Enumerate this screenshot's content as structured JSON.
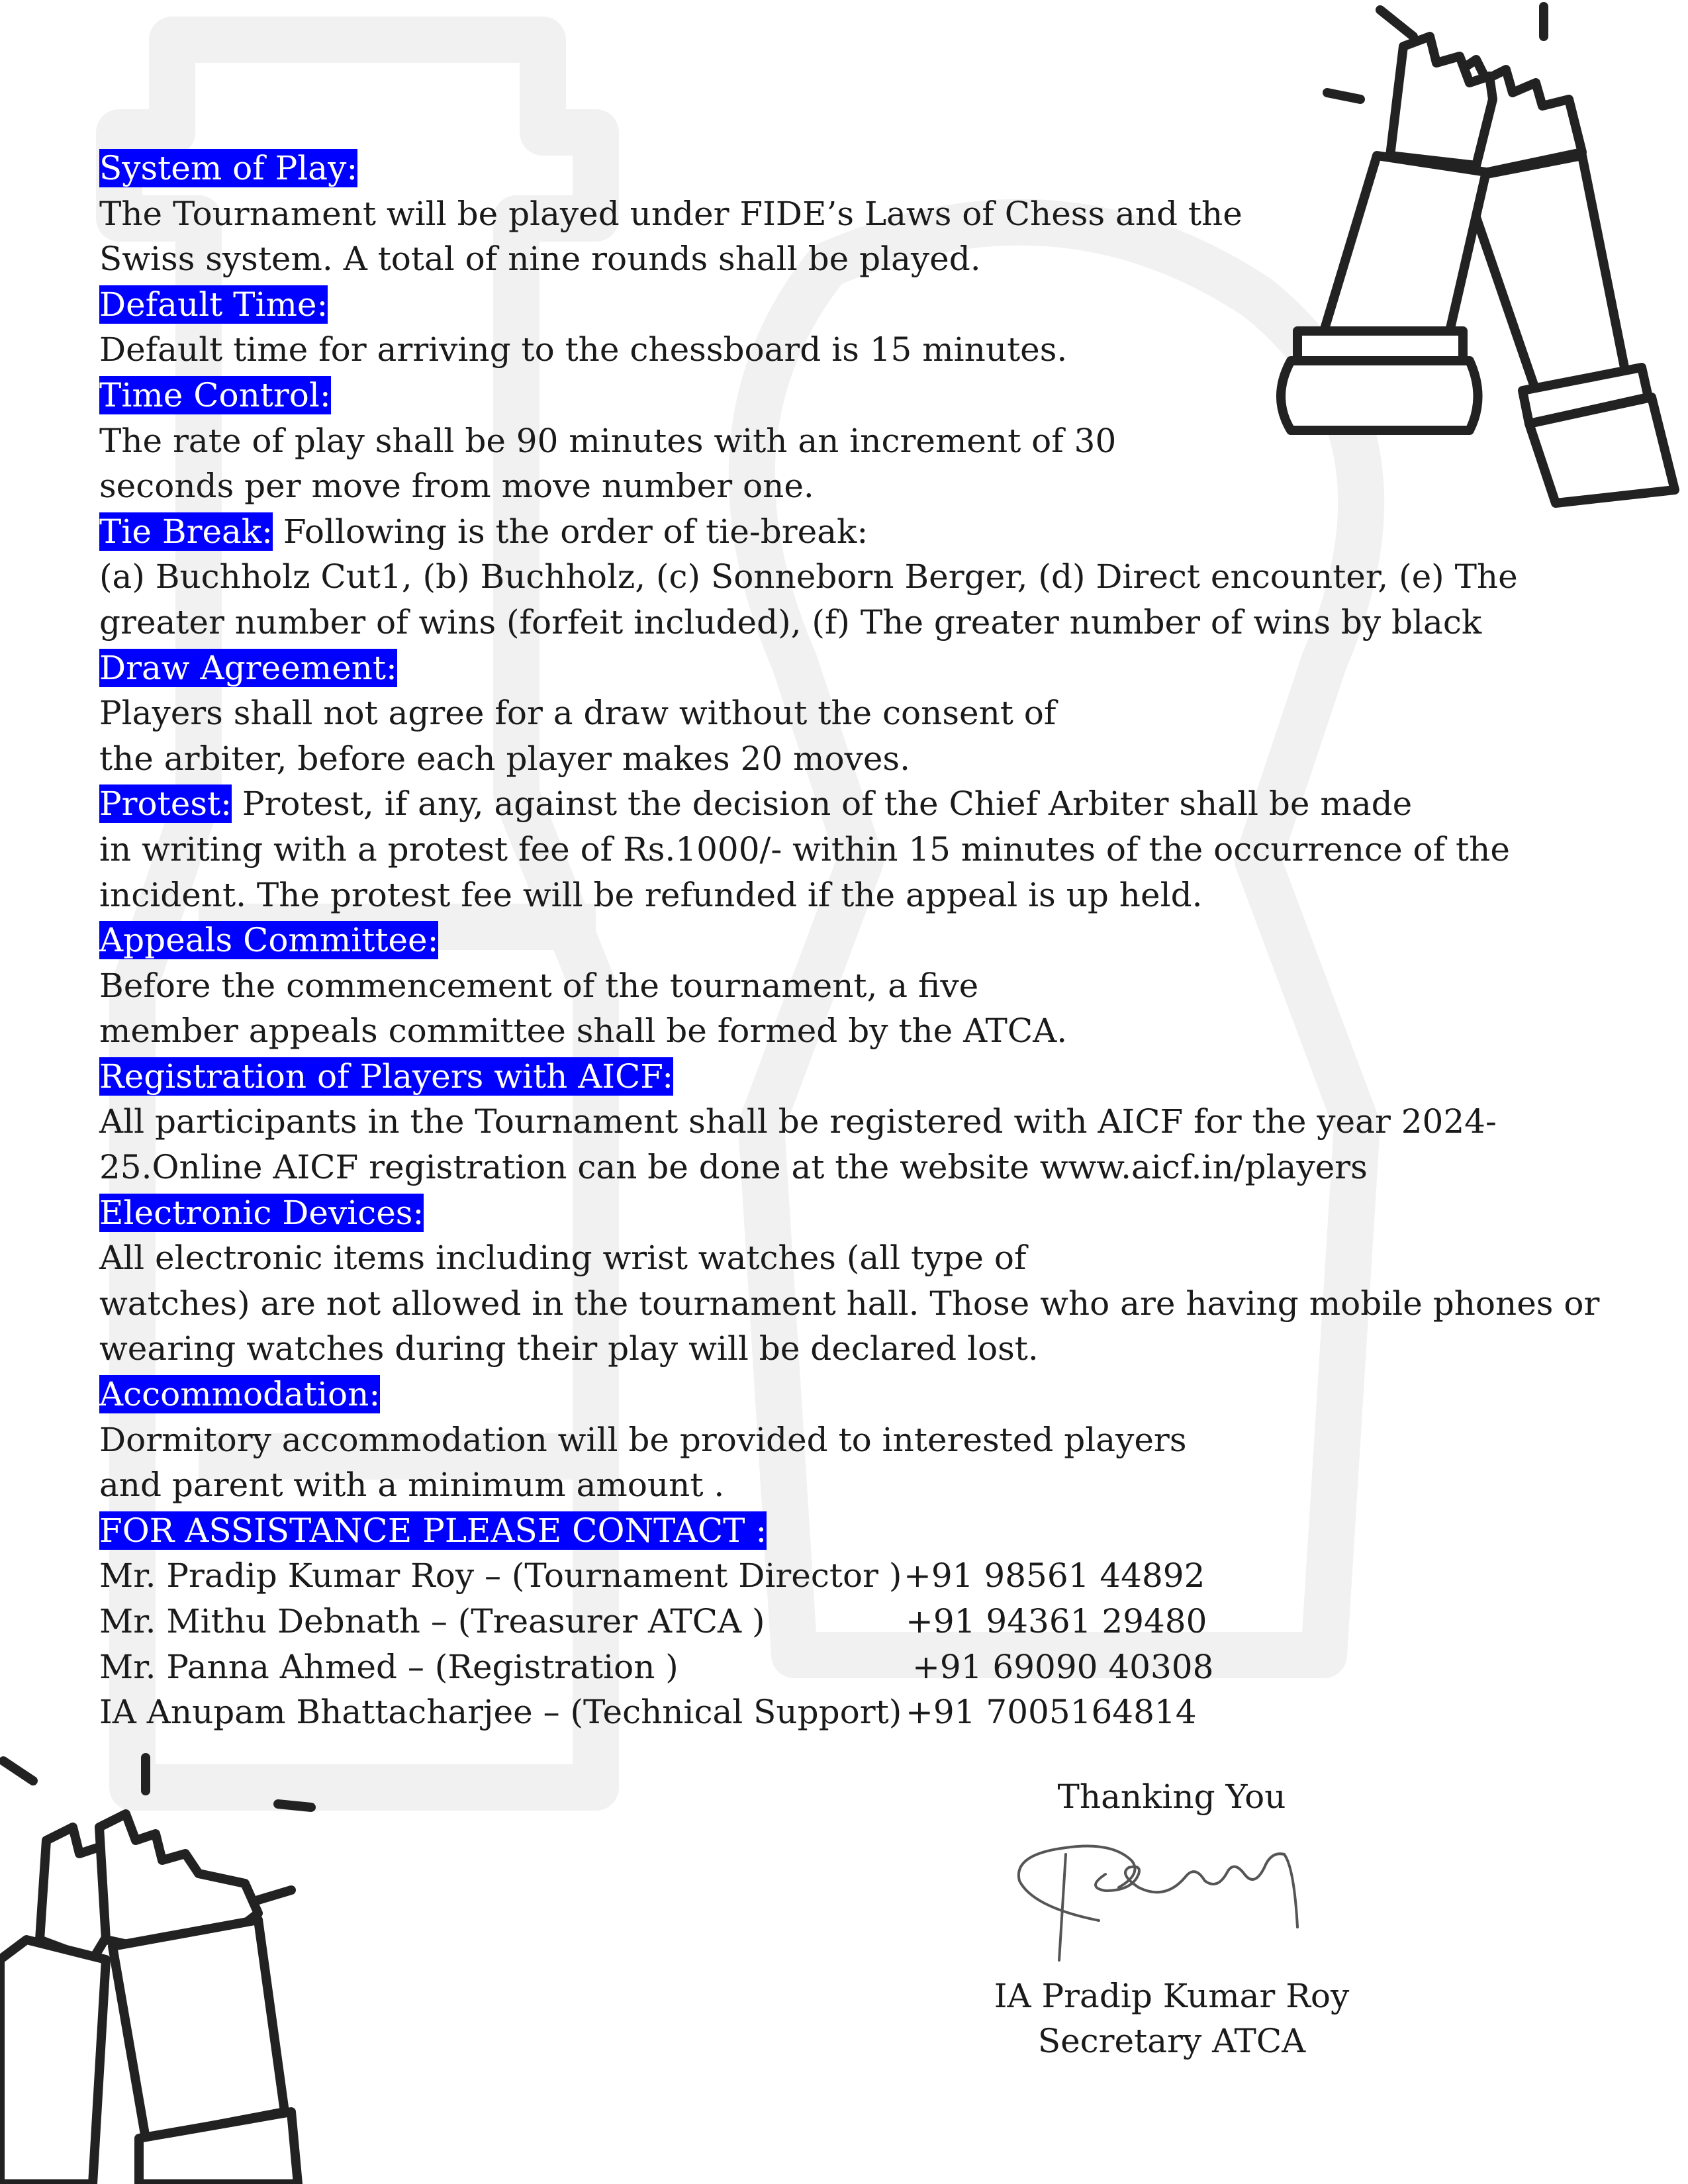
{
  "sections": [
    {
      "heading": "System of Play:",
      "inline": "",
      "lines": [
        "The Tournament will be played under FIDE’s Laws of Chess and the",
        "Swiss system. A total of nine rounds shall be played."
      ]
    },
    {
      "heading": "Default Time:",
      "inline": "",
      "lines": [
        "Default time for arriving to the chessboard is 15 minutes."
      ]
    },
    {
      "heading": "Time Control:",
      "inline": "",
      "lines": [
        "The rate of play shall be 90 minutes with an increment of 30",
        "seconds per move from move number one."
      ]
    },
    {
      "heading": "Tie Break:",
      "inline": " Following is the order of tie-break:",
      "lines": [
        "(a) Buchholz Cut1, (b) Buchholz, (c) Sonneborn Berger, (d) Direct encounter, (e) The",
        "greater number of wins (forfeit included), (f) The greater number of wins by black"
      ]
    },
    {
      "heading": "Draw Agreement:",
      "inline": "",
      "lines": [
        "Players shall not agree for a draw without the consent of",
        "the arbiter, before each player makes 20 moves."
      ]
    },
    {
      "heading": "Protest:",
      "inline": " Protest, if any, against the decision of the Chief Arbiter shall be made",
      "lines": [
        "in writing with a protest fee of Rs.1000/- within 15 minutes of the occurrence of the",
        "incident. The protest fee will be refunded if the appeal is up held."
      ]
    },
    {
      "heading": "Appeals Committee:",
      "inline": "",
      "lines": [
        "Before the commencement of the tournament, a five",
        "member appeals committee shall be formed by the ATCA."
      ]
    },
    {
      "heading": "Registration of Players with AICF:",
      "inline": "",
      "lines": [
        "All participants in the Tournament shall be registered with AICF for the year 2024-",
        "25.Online AICF registration can be done at the website www.aicf.in/players"
      ]
    },
    {
      "heading": "Electronic Devices:",
      "inline": "",
      "lines": [
        "All electronic items including wrist watches (all type of",
        "watches) are not allowed in the tournament hall. Those who are having mobile phones or",
        "wearing watches during their play will be declared lost."
      ]
    },
    {
      "heading": "Accommodation:",
      "inline": "",
      "lines": [
        "Dormitory accommodation will be provided to interested players",
        "and parent with a minimum amount ."
      ]
    }
  ],
  "assistance": {
    "heading": "FOR ASSISTANCE PLEASE CONTACT :",
    "contacts": [
      {
        "name": "Mr. Pradip Kumar Roy – (Tournament Director )",
        "phone": "+91 98561 44892"
      },
      {
        "name": "Mr. Mithu Debnath – (Treasurer ATCA )",
        "phone": "+91 94361 29480"
      },
      {
        "name": "Mr. Panna Ahmed – (Registration )",
        "phone": "+91 69090 40308"
      },
      {
        "name": "IA Anupam Bhattacharjee – (Technical Support)",
        "phone": "+91 7005164814"
      }
    ]
  },
  "closing": {
    "thanks": "Thanking You",
    "signatory_name": "IA Pradip Kumar Roy",
    "signatory_title": "Secretary ATCA"
  },
  "colors": {
    "heading_highlight": "#0000ff",
    "heading_text": "#ffffff",
    "body_text": "#1a1a1a",
    "watermark": "#f2f2f2",
    "icon_stroke": "#222222"
  },
  "icons": [
    "rook-chess-icon",
    "rook-chess-icon",
    "chess-piece-watermark"
  ]
}
